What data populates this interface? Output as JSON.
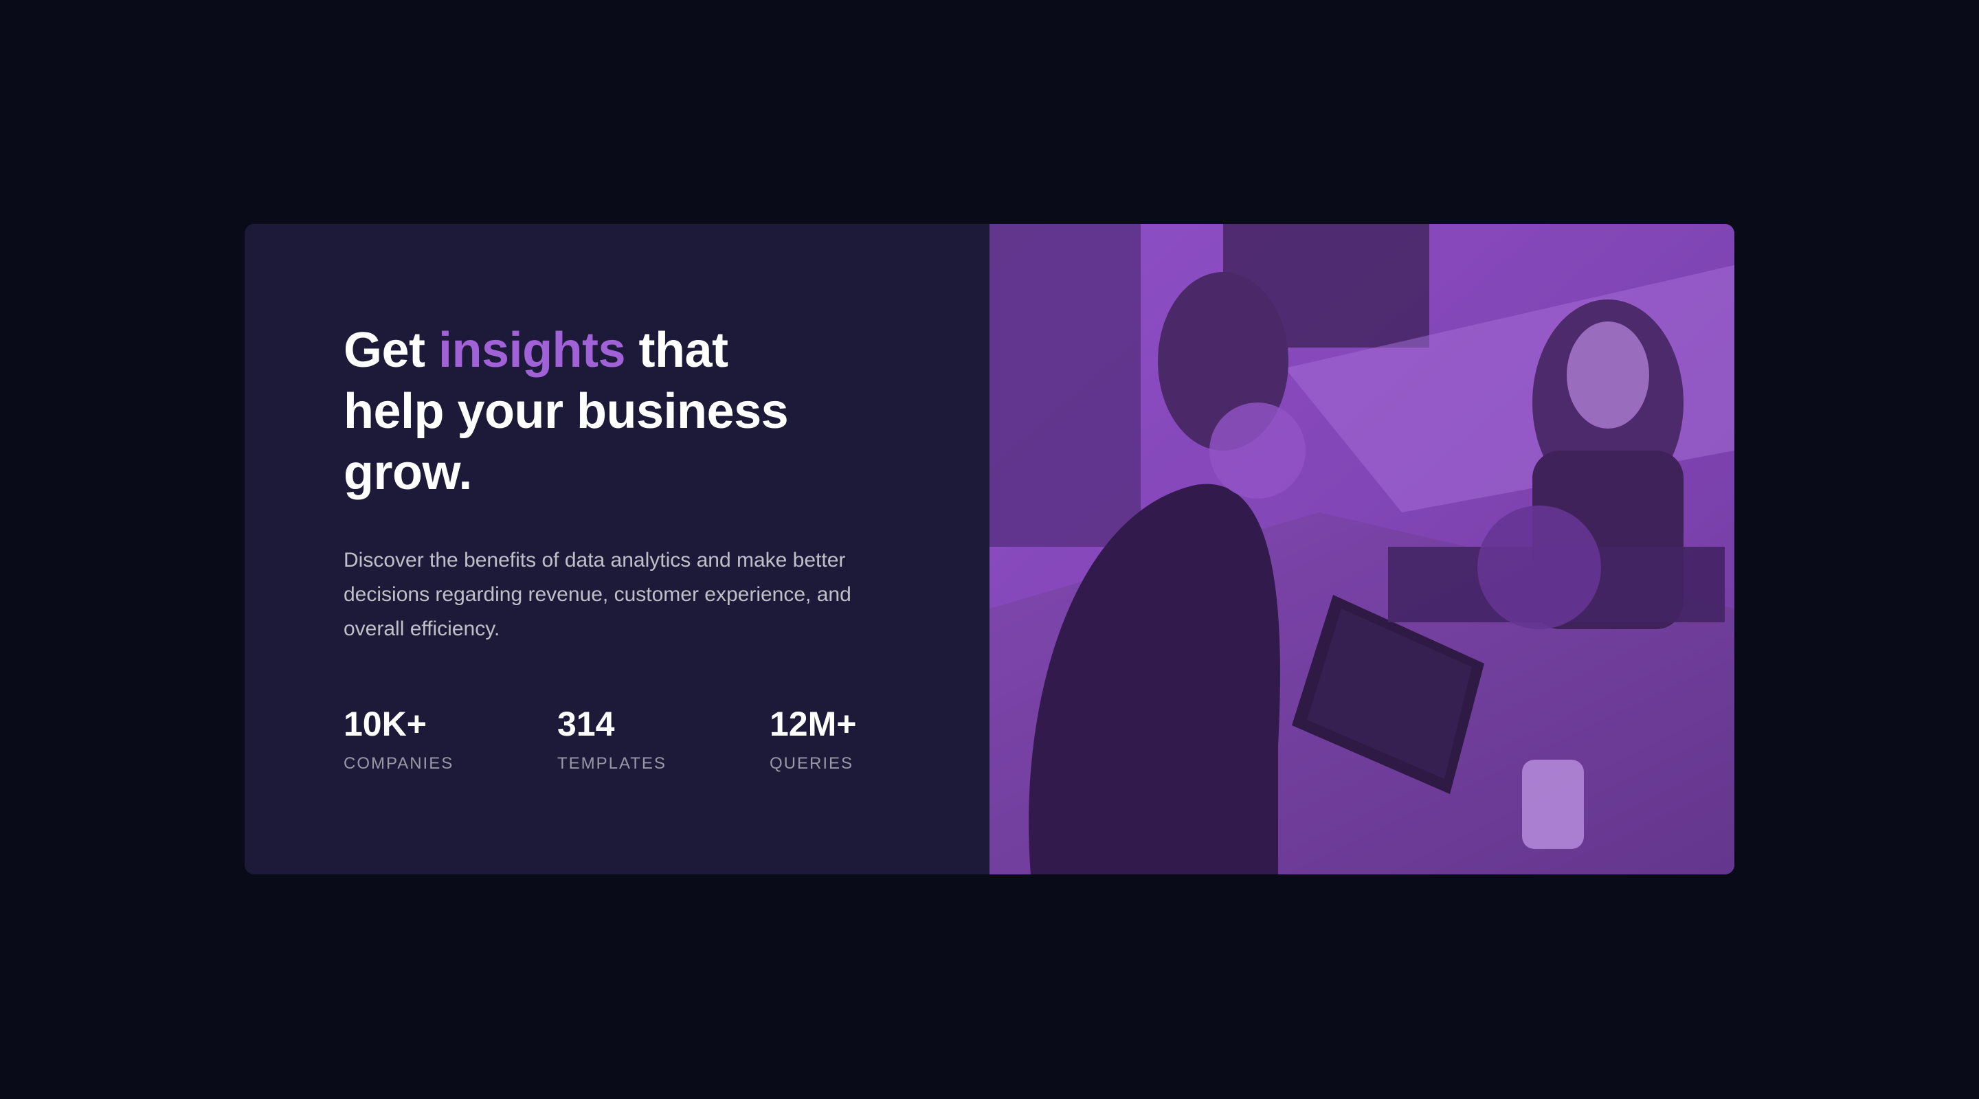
{
  "hero": {
    "headline_before": "Get ",
    "headline_accent": "insights",
    "headline_after": " that help your business grow.",
    "description": "Discover the benefits of data analytics and make better decisions regarding revenue, customer experience, and overall efficiency."
  },
  "stats": [
    {
      "value": "10K+",
      "label": "COMPANIES"
    },
    {
      "value": "314",
      "label": "TEMPLATES"
    },
    {
      "value": "12M+",
      "label": "QUERIES"
    }
  ],
  "image": {
    "alt": "People working together at a table with laptops",
    "tint_color": "#aa5cdb"
  },
  "colors": {
    "page_background": "#090b19",
    "card_background": "#1c1a38",
    "accent": "#a062d6"
  }
}
